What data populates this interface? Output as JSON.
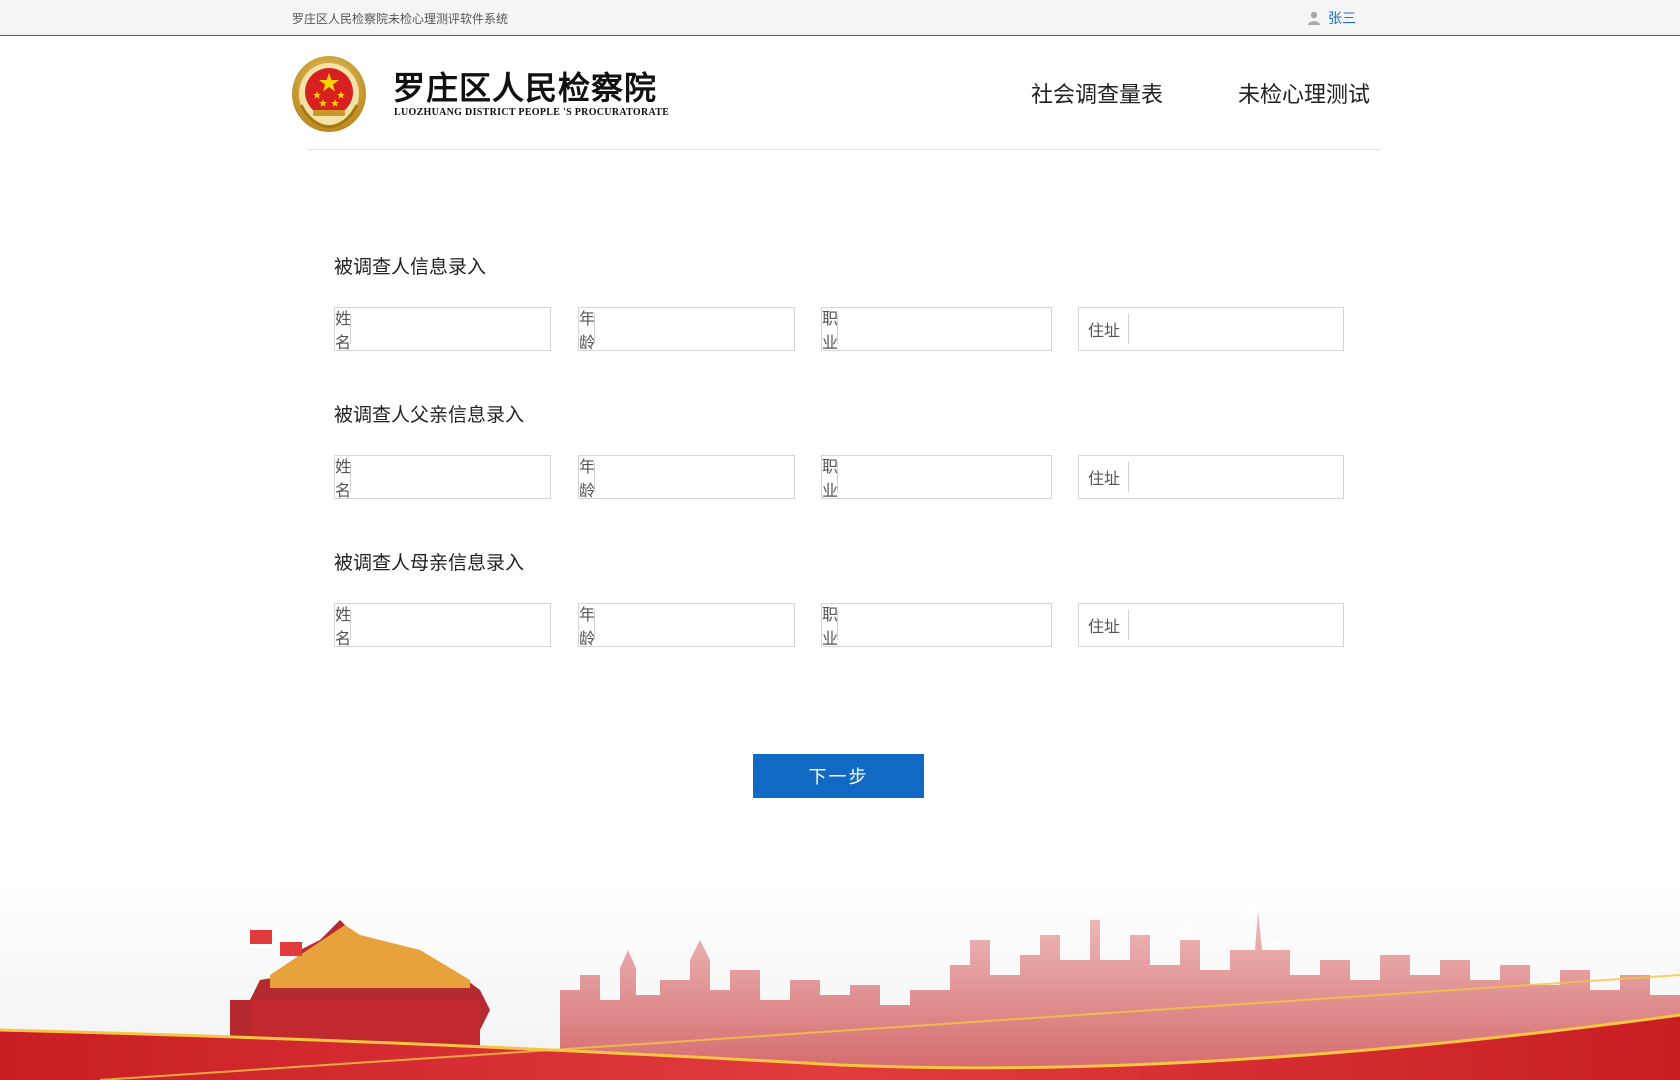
{
  "topbar": {
    "system_title": "罗庄区人民检察院未检心理测评软件系统",
    "user_name": "张三"
  },
  "header": {
    "brand_cn": "罗庄区人民检察院",
    "brand_en": "LUOZHUANG DISTRICT PEOPLE 'S PROCURATORATE",
    "nav": [
      "社会调查量表",
      "未检心理测试"
    ]
  },
  "sections": [
    {
      "title": "被调查人信息录入",
      "fields": [
        {
          "label": "姓名",
          "value": ""
        },
        {
          "label": "年龄",
          "value": ""
        },
        {
          "label": "职业",
          "value": ""
        },
        {
          "label": "住址",
          "value": ""
        }
      ]
    },
    {
      "title": "被调查人父亲信息录入",
      "fields": [
        {
          "label": "姓名",
          "value": ""
        },
        {
          "label": "年龄",
          "value": ""
        },
        {
          "label": "职业",
          "value": ""
        },
        {
          "label": "住址",
          "value": ""
        }
      ]
    },
    {
      "title": "被调查人母亲信息录入",
      "fields": [
        {
          "label": "姓名",
          "value": ""
        },
        {
          "label": "年龄",
          "value": ""
        },
        {
          "label": "职业",
          "value": ""
        },
        {
          "label": "住址",
          "value": ""
        }
      ]
    }
  ],
  "next_button": "下一步",
  "colors": {
    "accent": "#1169c4",
    "banner_red": "#d7262b"
  },
  "icons": {
    "user": "user-icon",
    "emblem": "procuratorate-emblem-icon"
  }
}
